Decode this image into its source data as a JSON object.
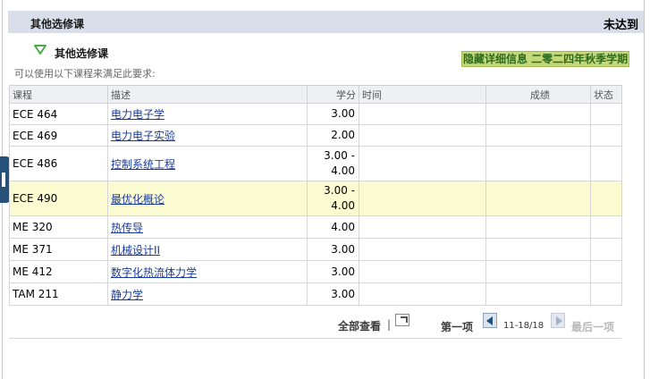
{
  "header": {
    "title": "其他选修课",
    "status": "未达到"
  },
  "subsection": {
    "title": "其他选修课",
    "toggle_icon": "triangle-down-icon"
  },
  "hint": "可以使用以下课程来满足此要求:",
  "hide_details_label": "隐藏详细信息 二零二四年秋季学期",
  "table": {
    "headers": {
      "course": "课程",
      "description": "描述",
      "credits": "学分",
      "term": "时间",
      "grade": "成绩",
      "status": "状态"
    },
    "rows": [
      {
        "course": "ECE 464",
        "description": "电力电子学",
        "credits": "3.00",
        "term": "",
        "grade": "",
        "status": ""
      },
      {
        "course": "ECE 469",
        "description": "电力电子实验",
        "credits": "2.00",
        "term": "",
        "grade": "",
        "status": ""
      },
      {
        "course": "ECE 486",
        "description": "控制系统工程",
        "credits": "3.00 - 4.00",
        "term": "",
        "grade": "",
        "status": ""
      },
      {
        "course": "ECE 490",
        "description": "最优化概论",
        "credits": "3.00 - 4.00",
        "term": "",
        "grade": "",
        "status": ""
      },
      {
        "course": "ME 320",
        "description": "热传导",
        "credits": "4.00",
        "term": "",
        "grade": "",
        "status": ""
      },
      {
        "course": "ME 371",
        "description": "机械设计II",
        "credits": "3.00",
        "term": "",
        "grade": "",
        "status": ""
      },
      {
        "course": "ME 412",
        "description": "数字化热流体力学",
        "credits": "3.00",
        "term": "",
        "grade": "",
        "status": ""
      },
      {
        "course": "TAM 211",
        "description": "静力学",
        "credits": "3.00",
        "term": "",
        "grade": "",
        "status": ""
      }
    ]
  },
  "nav": {
    "view_all": "全部查看",
    "separator": "|",
    "first": "第一项",
    "range": "11-18/18",
    "last": "最后一项"
  },
  "colors": {
    "header_bg": "#d9dfea",
    "highlight_row": "#fbfbd2",
    "link": "#1a3a9e",
    "toggle_green": "#4aa84a",
    "side_tab": "#24507a"
  }
}
